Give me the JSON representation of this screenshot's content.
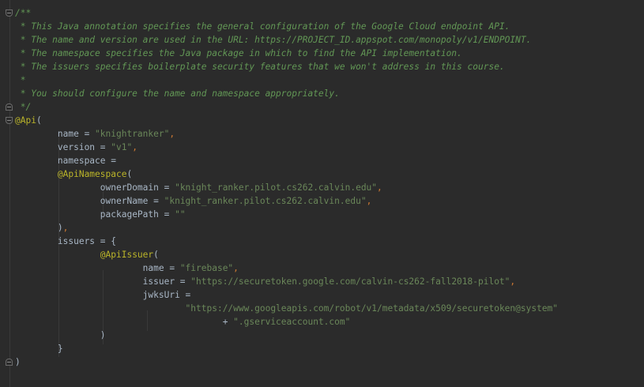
{
  "code": {
    "comment": {
      "open": "/**",
      "line1": " * This Java annotation specifies the general configuration of the Google Cloud endpoint API.",
      "line2": " * The name and version are used in the URL: https://PROJECT_ID.appspot.com/monopoly/v1/ENDPOINT.",
      "line3": " * The namespace specifies the Java package in which to find the API implementation.",
      "line4": " * The issuers specifies boilerplate security features that we won't address in this course.",
      "line5": " *",
      "line6": " * You should configure the name and namespace appropriately.",
      "close": " */"
    },
    "api_annotation": "@Api",
    "open_paren": "(",
    "close_paren": ")",
    "name_key": "name = ",
    "name_value": "\"knightranker\"",
    "version_key": "version = ",
    "version_value": "\"v1\"",
    "comma": ",",
    "namespace_key": "namespace =",
    "api_namespace_annotation": "@ApiNamespace",
    "owner_domain_key": "ownerDomain = ",
    "owner_domain_value": "\"knight_ranker.pilot.cs262.calvin.edu\"",
    "owner_name_key": "ownerName = ",
    "owner_name_value": "\"knight_ranker.pilot.cs262.calvin.edu\"",
    "package_path_key": "packagePath = ",
    "package_path_value": "\"\"",
    "issuers_key": "issuers = {",
    "api_issuer_annotation": "@ApiIssuer",
    "issuer_name_key": "name = ",
    "issuer_name_value": "\"firebase\"",
    "issuer_key": "issuer = ",
    "issuer_value": "\"https://securetoken.google.com/calvin-cs262-fall2018-pilot\"",
    "jwks_key": "jwksUri =",
    "jwks_value_1": "\"https://www.googleapis.com/robot/v1/metadata/x509/securetoken@system\"",
    "plus": "+ ",
    "jwks_value_2": "\".gserviceaccount.com\"",
    "close_brace": "}"
  }
}
